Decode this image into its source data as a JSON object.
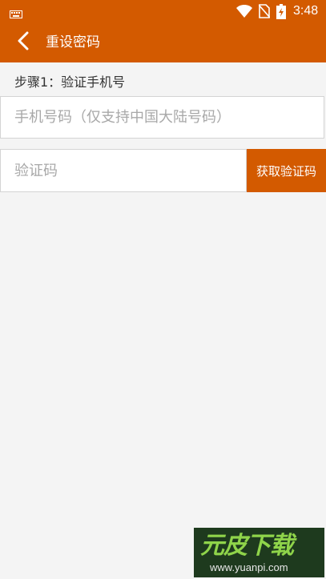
{
  "status_bar": {
    "time": "3:48",
    "icons": [
      "keyboard-icon",
      "wifi-icon",
      "no-sim-icon",
      "battery-icon"
    ]
  },
  "toolbar": {
    "title": "重设密码",
    "back_icon": "chevron-left-icon"
  },
  "form": {
    "step_label": "步骤1：验证手机号",
    "phone_field": {
      "value": "",
      "placeholder": "手机号码（仅支持中国大陆号码）"
    },
    "code_field": {
      "value": "",
      "placeholder": "验证码"
    },
    "get_code_label": "获取验证码"
  },
  "watermark": {
    "logo_text": "元皮下载",
    "url": "www.yuanpi.com"
  },
  "colors": {
    "accent": "#d35a00",
    "background": "#f4f4f4",
    "field_border": "#d4d4d4",
    "placeholder": "#a8a8a8"
  }
}
